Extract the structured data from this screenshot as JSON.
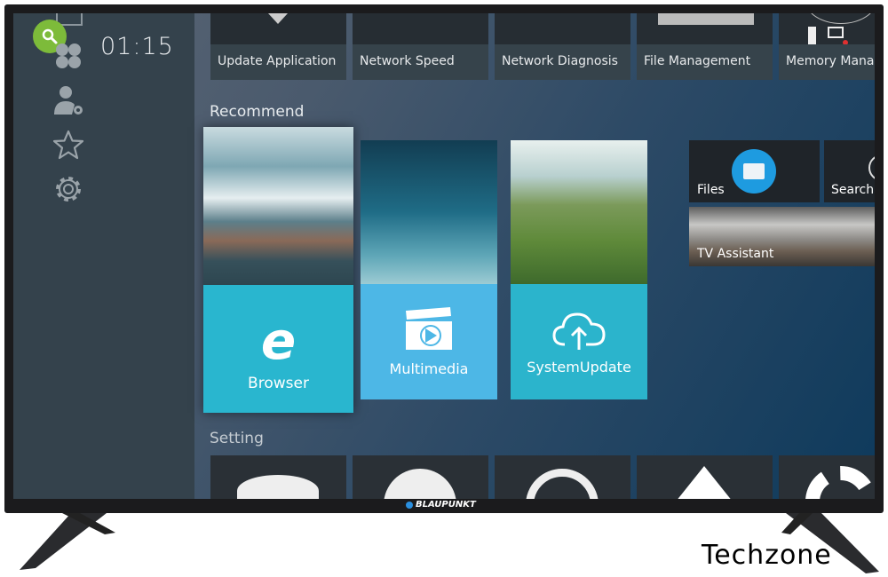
{
  "clock": "01:15",
  "sidebar": {
    "icons": [
      "search-icon",
      "apps-icon",
      "user-settings-icon",
      "favorites-icon",
      "settings-icon"
    ]
  },
  "top_tiles": [
    "Update Application",
    "Network Speed",
    "Network Diagnosis",
    "File Management",
    "Memory Mana"
  ],
  "recommend": {
    "title": "Recommend",
    "tiles": [
      {
        "label": "Browser",
        "color": "#29b6cf"
      },
      {
        "label": "Multimedia",
        "color": "#4db7e6"
      },
      {
        "label": "SystemUpdate",
        "color": "#2bb4cc"
      }
    ],
    "small_tiles": [
      "Files",
      "Search",
      "TV Assistant"
    ]
  },
  "setting": {
    "title": "Setting"
  },
  "brand": "BLAUPUNKT",
  "watermark": "Techzone",
  "colors": {
    "sidebar": "#34424c",
    "search_bubble": "#7dbb3a"
  }
}
